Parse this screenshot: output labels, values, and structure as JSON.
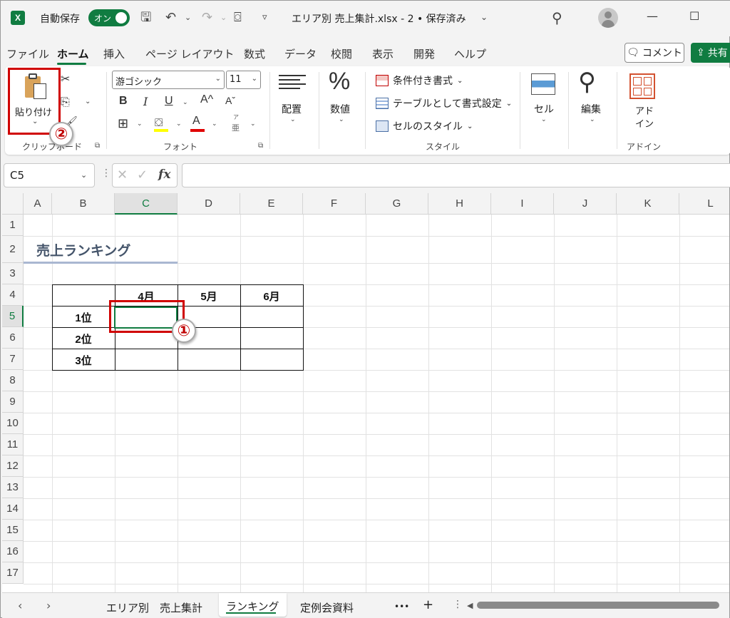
{
  "titlebar": {
    "logo": "X",
    "autosave_label": "自動保存",
    "autosave_state": "オン",
    "document_title": "エリア別 売上集計.xlsx  -  2 • 保存済み",
    "icons": [
      "save-icon",
      "undo-icon",
      "redo-icon",
      "camera-icon",
      "customize-icon",
      "search-icon"
    ]
  },
  "menu": {
    "tabs": [
      "ファイル",
      "ホーム",
      "挿入",
      "ページ レイアウト",
      "数式",
      "データ",
      "校閲",
      "表示",
      "開発",
      "ヘルプ"
    ],
    "active": "ホーム",
    "comment_label": "コメント",
    "share_label": "共有"
  },
  "ribbon": {
    "clipboard": {
      "paste_label": "貼り付け",
      "group_label": "クリップボード"
    },
    "font": {
      "font_name": "游ゴシック",
      "font_size": "11",
      "bold": "B",
      "italic": "I",
      "underline": "U",
      "grow": "A^",
      "shrink": "Aˇ",
      "phonetic_top": "ア",
      "phonetic_bottom": "亜",
      "group_label": "フォント"
    },
    "alignment": {
      "label": "配置"
    },
    "number": {
      "symbol": "%",
      "label": "数値"
    },
    "styles": {
      "conditional": "条件付き書式",
      "as_table": "テーブルとして書式設定",
      "cell_styles": "セルのスタイル",
      "group_label": "スタイル"
    },
    "cells": {
      "label": "セル"
    },
    "editing": {
      "label": "編集"
    },
    "addins": {
      "label_line1": "アド",
      "label_line2": "イン",
      "group_label": "アドイン"
    }
  },
  "formula_bar": {
    "name_box": "C5",
    "fx": "fx",
    "formula": ""
  },
  "grid": {
    "columns": [
      "A",
      "B",
      "C",
      "D",
      "E",
      "F",
      "G",
      "H",
      "I",
      "J",
      "K",
      "L"
    ],
    "rows": [
      "1",
      "2",
      "3",
      "4",
      "5",
      "6",
      "7",
      "8",
      "9",
      "10",
      "11",
      "12",
      "13",
      "14",
      "15",
      "16",
      "17"
    ],
    "selected_column": "C",
    "selected_row": "5"
  },
  "sheet": {
    "title": "売上ランキング",
    "table_headers": [
      "4月",
      "5月",
      "6月"
    ],
    "row_labels": [
      "1位",
      "2位",
      "3位"
    ]
  },
  "annotations": {
    "callout_1": "①",
    "callout_2": "②"
  },
  "sheet_tabs": {
    "tabs": [
      "エリア別　売上集計",
      "ランキング",
      "定例会資料"
    ],
    "active": "ランキング",
    "more": "•••",
    "add": "+"
  },
  "colors": {
    "accent": "#107c41",
    "highlight_red": "#d00000"
  }
}
